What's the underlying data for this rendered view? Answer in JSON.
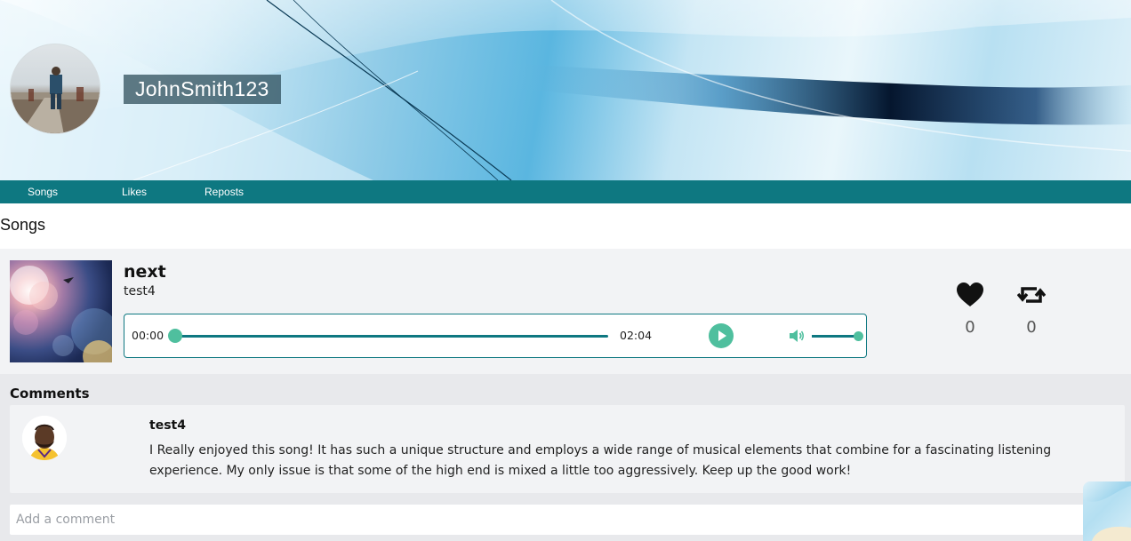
{
  "profile": {
    "username": "JohnSmith123",
    "avatar_icon": "profile-photo",
    "banner_icon": "abstract-blue-waves"
  },
  "nav": {
    "items": [
      {
        "label": "Songs"
      },
      {
        "label": "Likes"
      },
      {
        "label": "Reposts"
      }
    ]
  },
  "songs_section": {
    "title": "Songs"
  },
  "song": {
    "title": "next",
    "artist": "test4",
    "cover_icon": "bokeh-light-art",
    "player": {
      "current_time": "00:00",
      "duration": "02:04",
      "progress": 0,
      "volume": 1.0,
      "play_icon": "play-icon",
      "volume_icon": "volume-icon"
    },
    "likes": {
      "icon": "heart-icon",
      "count": "0"
    },
    "reposts": {
      "icon": "repost-icon",
      "count": "0"
    }
  },
  "comments": {
    "title": "Comments",
    "items": [
      {
        "user": "test4",
        "avatar_icon": "user-avatar",
        "text": "I Really enjoyed this song! It has such a unique structure and employs a wide range of musical elements that combine for a fascinating listening experience. My only issue is that some of the high end is mixed a little too aggressively. Keep up the good work!"
      }
    ],
    "add_placeholder": "Add a comment"
  },
  "colors": {
    "accent": "#0e7881",
    "player_green": "#4fbf9e",
    "card_bg": "#f2f3f5",
    "comments_bg": "#e8e9ec"
  }
}
